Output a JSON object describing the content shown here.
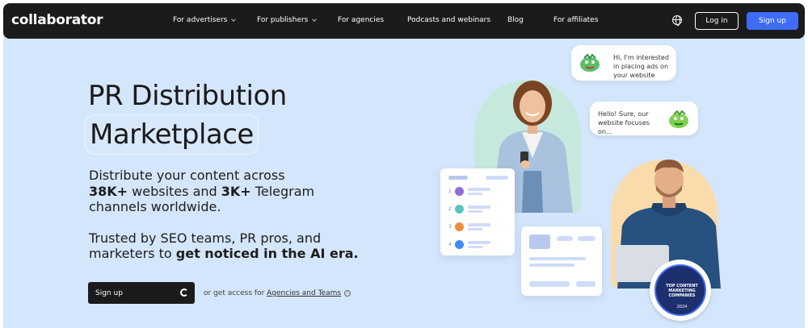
{
  "header": {
    "logo": "collaborator",
    "menu": [
      {
        "label": "For advertisers",
        "has_dropdown": true
      },
      {
        "label": "For publishers",
        "has_dropdown": true
      },
      {
        "label": "For agencies",
        "has_dropdown": false
      },
      {
        "label": "Podcasts and webinars",
        "has_dropdown": false
      },
      {
        "label": "Blog",
        "has_dropdown": false
      },
      {
        "label": "For affiliates",
        "has_dropdown": false
      }
    ],
    "language_icon": "globe-icon",
    "login_label": "Log in",
    "signup_label": "Sign up"
  },
  "hero": {
    "title_line1": "PR Distribution",
    "title_line2": "Marketplace",
    "desc1_pre": "Distribute your content across",
    "desc1_bold1": "38K+",
    "desc1_mid": " websites and ",
    "desc1_bold2": "3K+",
    "desc1_post": " Telegram",
    "desc1_line3": "channels worldwide.",
    "desc2_line1": "Trusted by SEO teams, PR pros, and",
    "desc2_pre": "marketers to ",
    "desc2_bold": "get noticed in the AI era.",
    "cta_label": "Sign up",
    "access_pre": "or get access for ",
    "access_link": "Agencies and Teams"
  },
  "illustration": {
    "bubble1": "Hi, I'm interested in placing ads on your website",
    "bubble2": "Hello! Sure, our website focuses on...",
    "list_numbers": [
      "1",
      "2",
      "3",
      "4"
    ],
    "list_colors": [
      "#8b6fd6",
      "#57c7c2",
      "#f28a3c",
      "#3f8cf5"
    ],
    "badge_text": "TOP CONTENT MARKETING COMPANIES",
    "badge_year": "2024"
  },
  "colors": {
    "background": "#d4e6fb",
    "nav": "#1b1b1d",
    "accent": "#3f6cf7"
  }
}
